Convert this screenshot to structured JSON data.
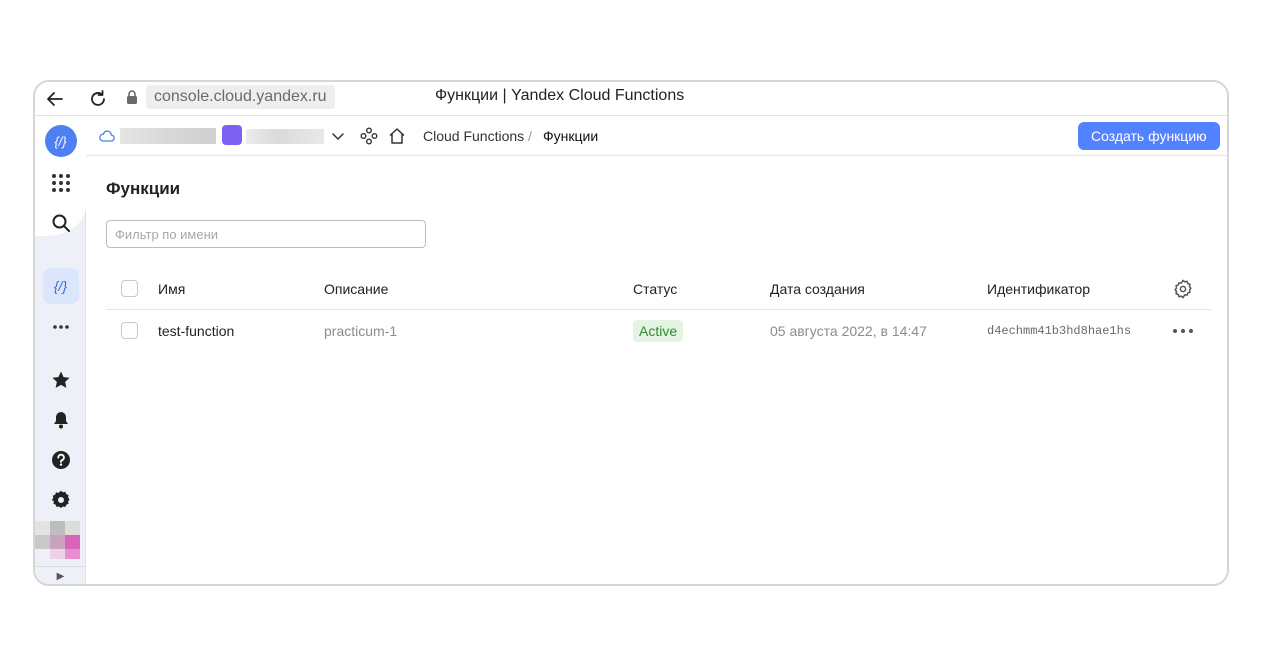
{
  "browser": {
    "url": "console.cloud.yandex.ru",
    "title": "Функции | Yandex Cloud Functions"
  },
  "sidebar": {
    "logo_text": "{/}",
    "active_service_text": "{/}",
    "icons": [
      "back-arrow-icon",
      "reload-icon",
      "lock-icon",
      "apps-grid-icon",
      "search-icon",
      "functions-icon",
      "more-dots-icon",
      "star-icon",
      "bell-icon",
      "help-icon",
      "gear-icon",
      "expand-arrow-icon"
    ]
  },
  "topbar": {
    "breadcrumb_service": "Cloud Functions",
    "breadcrumb_separator": "/",
    "breadcrumb_current": "Функции",
    "create_button": "Создать функцию"
  },
  "main": {
    "title": "Функции",
    "filter_placeholder": "Фильтр по имени",
    "columns": {
      "name": "Имя",
      "description": "Описание",
      "status": "Статус",
      "created": "Дата создания",
      "id": "Идентификатор"
    },
    "rows": [
      {
        "name": "test-function",
        "description": "practicum-1",
        "status": "Active",
        "created": "05 августа 2022, в 14:47",
        "id": "d4echmm41b3hd8hae1hs"
      }
    ]
  },
  "colors": {
    "accent": "#5282ff",
    "project": "#7b62f0",
    "status_active_bg": "#e3f4e3",
    "status_active_text": "#2f8a2f"
  }
}
